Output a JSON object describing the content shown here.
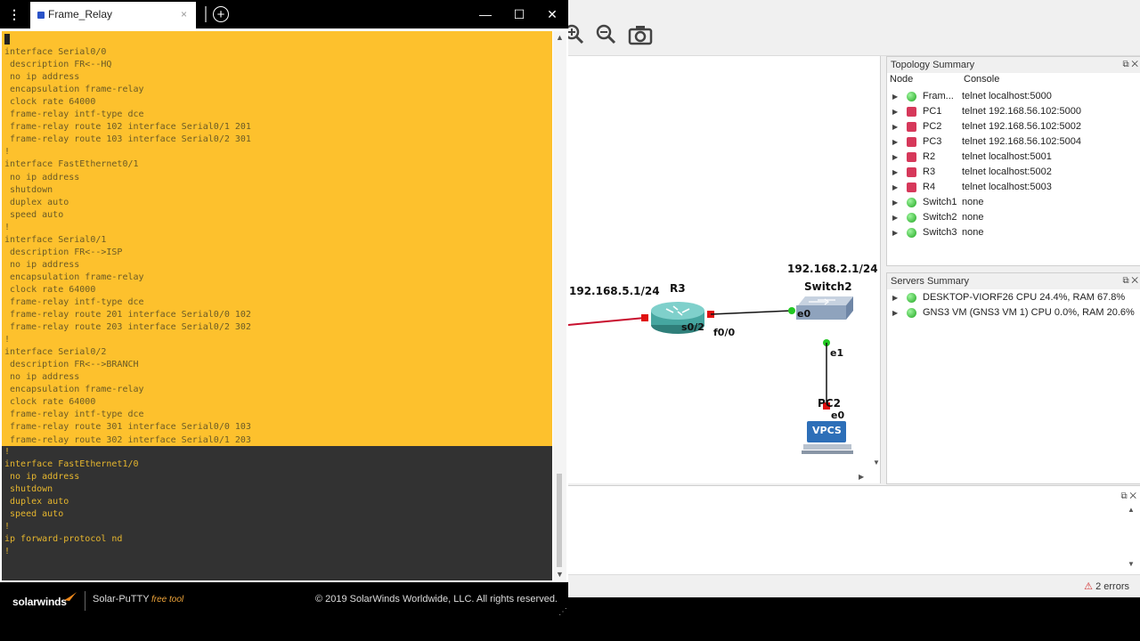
{
  "putty": {
    "tab_title": "Frame_Relay",
    "tab_close": "×",
    "add_tab": "+",
    "menu": "⋮",
    "minimize": "—",
    "maximize": "☐",
    "close": "✕",
    "terminal_lines_yellow": [
      "!",
      "interface Serial0/0",
      " description FR<--HQ",
      " no ip address",
      " encapsulation frame-relay",
      " clock rate 64000",
      " frame-relay intf-type dce",
      " frame-relay route 102 interface Serial0/1 201",
      " frame-relay route 103 interface Serial0/2 301",
      "!",
      "interface FastEthernet0/1",
      " no ip address",
      " shutdown",
      " duplex auto",
      " speed auto",
      "!",
      "interface Serial0/1",
      " description FR<-->ISP",
      " no ip address",
      " encapsulation frame-relay",
      " clock rate 64000",
      " frame-relay intf-type dce",
      " frame-relay route 201 interface Serial0/0 102",
      " frame-relay route 203 interface Serial0/2 302",
      "!",
      "interface Serial0/2",
      " description FR<-->BRANCH",
      " no ip address",
      " encapsulation frame-relay",
      " clock rate 64000",
      " frame-relay intf-type dce",
      " frame-relay route 301 interface Serial0/0 103",
      " frame-relay route 302 interface Serial0/1 203"
    ],
    "terminal_lines_dark": [
      "!",
      "interface FastEthernet1/0",
      " no ip address",
      " shutdown",
      " duplex auto",
      " speed auto",
      "!",
      "ip forward-protocol nd",
      "!"
    ],
    "footer": {
      "brand": "solarwinds",
      "product": "Solar-PuTTY",
      "free_tool": "free tool",
      "copyright": "© 2019 SolarWinds Worldwide, LLC. All rights reserved."
    }
  },
  "gns3": {
    "topology": {
      "r3_label": "R3",
      "r3_ip": "192.168.5.1/24",
      "r3_s02": "s0/2",
      "r3_f00": "f0/0",
      "switch_label": "Switch2",
      "switch_ip": "192.168.2.1/24",
      "switch_e0": "e0",
      "switch_e1": "e1",
      "pc_label": "PC2",
      "pc_e0": "e0",
      "vpcs": "VPCS"
    },
    "topology_summary": {
      "title": "Topology Summary",
      "col_node": "Node",
      "col_console": "Console",
      "rows": [
        {
          "node": "Fram...",
          "console": "telnet localhost:5000",
          "status": "green"
        },
        {
          "node": "PC1",
          "console": "telnet 192.168.56.102:5000",
          "status": "red"
        },
        {
          "node": "PC2",
          "console": "telnet 192.168.56.102:5002",
          "status": "red"
        },
        {
          "node": "PC3",
          "console": "telnet 192.168.56.102:5004",
          "status": "red"
        },
        {
          "node": "R2",
          "console": "telnet localhost:5001",
          "status": "red"
        },
        {
          "node": "R3",
          "console": "telnet localhost:5002",
          "status": "red"
        },
        {
          "node": "R4",
          "console": "telnet localhost:5003",
          "status": "red"
        },
        {
          "node": "Switch1",
          "console": "none",
          "status": "green"
        },
        {
          "node": "Switch2",
          "console": "none",
          "status": "green"
        },
        {
          "node": "Switch3",
          "console": "none",
          "status": "green"
        }
      ]
    },
    "servers_summary": {
      "title": "Servers Summary",
      "rows": [
        "DESKTOP-VIORF26 CPU 24.4%, RAM 67.8%",
        "GNS3 VM (GNS3 VM 1) CPU 0.0%, RAM 20.6%"
      ]
    },
    "status": {
      "errors": "2 errors"
    },
    "colors": {
      "terminal_yellow": "#fdc12d",
      "terminal_dark": "#323232",
      "link_red": "#c8102e",
      "port_green": "#22c822",
      "port_red": "#e01010"
    }
  }
}
